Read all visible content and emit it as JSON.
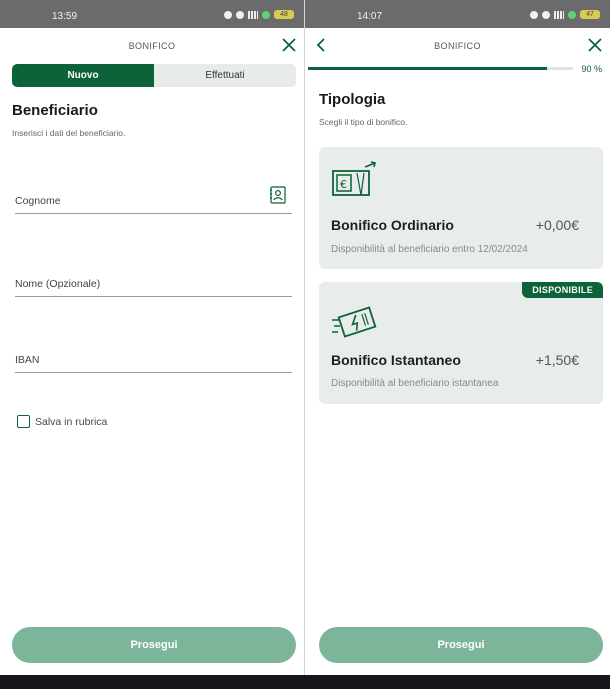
{
  "colors": {
    "primary": "#0c6239",
    "cta_disabled": "#7db59a",
    "card_bg": "#e8ecea"
  },
  "left": {
    "status": {
      "time": "13:59",
      "battery": "48"
    },
    "nav": {
      "title": "BONIFICO"
    },
    "segment": {
      "active": "Nuovo",
      "inactive": "Effettuati"
    },
    "section": {
      "title": "Beneficiario",
      "subtitle": "Inserisci i dati del beneficiario."
    },
    "fields": [
      {
        "label": "Cognome"
      },
      {
        "label": "Nome (Opzionale)"
      },
      {
        "label": "IBAN"
      }
    ],
    "checkbox": {
      "label": "Salva in rubrica",
      "checked": false
    },
    "cta": "Prosegui"
  },
  "right": {
    "status": {
      "time": "14:07",
      "battery": "47"
    },
    "nav": {
      "title": "BONIFICO"
    },
    "progress": {
      "value": 0.9,
      "label": "90 %"
    },
    "section": {
      "title": "Tipologia",
      "subtitle": "Scegli il tipo di bonifico."
    },
    "cards": [
      {
        "icon": "euro-banknote-icon",
        "title": "Bonifico Ordinario",
        "price": "+0,00€",
        "subtitle": "Disponibilità al beneficiario entro 12/02/2024",
        "badge": ""
      },
      {
        "icon": "instant-banknote-icon",
        "title": "Bonifico Istantaneo",
        "price": "+1,50€",
        "subtitle": "Disponibilità al beneficiario istantanea",
        "badge": "DISPONIBILE"
      }
    ],
    "cta": "Prosegui"
  }
}
